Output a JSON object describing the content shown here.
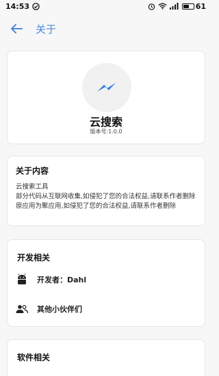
{
  "status_bar": {
    "time": "14:53",
    "battery": "61",
    "battery_level": 0.61
  },
  "toolbar": {
    "title": "关于"
  },
  "app_card": {
    "name": "云搜索",
    "version": "版本号:1.0.0"
  },
  "about": {
    "title": "关于内容",
    "lines": [
      "云搜索工具",
      "部分代码从互联网收集,如侵犯了您的合法权益,请联系作者删除",
      "原应用为聚应用,如侵犯了您的合法权益,请联系作者删除"
    ]
  },
  "developer": {
    "title": "开发相关",
    "items": [
      {
        "label": "开发者：Dahl",
        "icon": "android-icon"
      },
      {
        "label": "其他小伙伴们",
        "icon": "people-icon"
      }
    ]
  },
  "software": {
    "title": "软件相关"
  },
  "colors": {
    "accent": "#4a89dc",
    "logo": "#2f7de1"
  }
}
